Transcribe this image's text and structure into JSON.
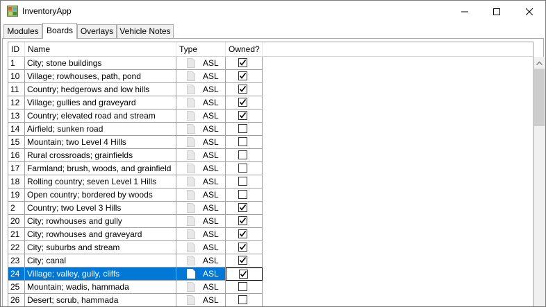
{
  "window": {
    "title": "InventoryApp",
    "icon": "map-board-icon",
    "controls": [
      "minimize-icon",
      "maximize-icon",
      "close-icon"
    ]
  },
  "tabs": [
    {
      "label": "Modules",
      "active": false
    },
    {
      "label": "Boards",
      "active": true
    },
    {
      "label": "Overlays",
      "active": false
    },
    {
      "label": "Vehicle Notes",
      "active": false
    }
  ],
  "grid": {
    "columns": {
      "id": "ID",
      "name": "Name",
      "type": "Type",
      "owned": "Owned?"
    },
    "rows": [
      {
        "id": "1",
        "name": "City; stone buildings",
        "type": "ASL",
        "owned": true
      },
      {
        "id": "10",
        "name": "Village; rowhouses, path, pond",
        "type": "ASL",
        "owned": true
      },
      {
        "id": "11",
        "name": "Country; hedgerows and low hills",
        "type": "ASL",
        "owned": true
      },
      {
        "id": "12",
        "name": "Village; gullies and graveyard",
        "type": "ASL",
        "owned": true
      },
      {
        "id": "13",
        "name": "Country; elevated road and stream",
        "type": "ASL",
        "owned": true
      },
      {
        "id": "14",
        "name": "Airfield; sunken road",
        "type": "ASL",
        "owned": false
      },
      {
        "id": "15",
        "name": "Mountain; two Level 4 Hills",
        "type": "ASL",
        "owned": false
      },
      {
        "id": "16",
        "name": "Rural crossroads; grainfields",
        "type": "ASL",
        "owned": false
      },
      {
        "id": "17",
        "name": "Farmland; brush, woods, and grainfield",
        "type": "ASL",
        "owned": false
      },
      {
        "id": "18",
        "name": "Rolling country; seven Level 1 Hills",
        "type": "ASL",
        "owned": false
      },
      {
        "id": "19",
        "name": "Open country; bordered by woods",
        "type": "ASL",
        "owned": false
      },
      {
        "id": "2",
        "name": "Country; two Level 3 Hills",
        "type": "ASL",
        "owned": true
      },
      {
        "id": "20",
        "name": "City; rowhouses and gully",
        "type": "ASL",
        "owned": true
      },
      {
        "id": "21",
        "name": "City; rowhouses and graveyard",
        "type": "ASL",
        "owned": true
      },
      {
        "id": "22",
        "name": "City; suburbs and stream",
        "type": "ASL",
        "owned": true
      },
      {
        "id": "23",
        "name": "City; canal",
        "type": "ASL",
        "owned": true
      },
      {
        "id": "24",
        "name": "Village; valley, gully, cliffs",
        "type": "ASL",
        "owned": true,
        "selected": true
      },
      {
        "id": "25",
        "name": "Mountain; wadis, hammada",
        "type": "ASL",
        "owned": false
      },
      {
        "id": "26",
        "name": "Desert; scrub, hammada",
        "type": "ASL",
        "owned": false
      }
    ]
  },
  "colors": {
    "selection": "#0078d7",
    "gridline": "#a0a0a0",
    "scroll_thumb": "#cdcdcd"
  }
}
